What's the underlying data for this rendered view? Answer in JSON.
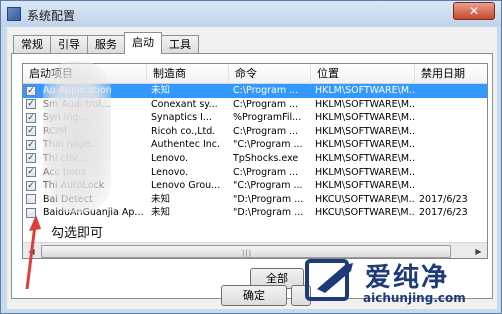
{
  "window": {
    "title": "系统配置",
    "close_glyph": "✕"
  },
  "tabs": [
    {
      "label": "常规",
      "active": false
    },
    {
      "label": "引导",
      "active": false
    },
    {
      "label": "服务",
      "active": false
    },
    {
      "label": "启动",
      "active": true
    },
    {
      "label": "工具",
      "active": false
    }
  ],
  "list": {
    "columns": [
      "启动项目",
      "制造商",
      "命令",
      "位置",
      "禁用日期"
    ],
    "rows": [
      {
        "checked": true,
        "item": "Ap  Application",
        "maker": "未知",
        "cmd": "C:\\Program ...",
        "loc": "HKLM\\SOFTWARE\\M...",
        "date": "",
        "selected": true
      },
      {
        "checked": true,
        "item": "Sm  Audi  trol...",
        "maker": "Conexant sy...",
        "cmd": "C:\\Program ...",
        "loc": "HKLM\\SOFTWARE\\M...",
        "date": ""
      },
      {
        "checked": true,
        "item": "Syn     ing...",
        "maker": "Synaptics I...",
        "cmd": "%ProgramFil...",
        "loc": "HKLM\\SOFTWARE\\M...",
        "date": ""
      },
      {
        "checked": true,
        "item": "RCIM  ",
        "maker": "Ricoh co.,Ltd.",
        "cmd": "C:\\Program ...",
        "loc": "HKLM\\SOFTWARE\\M...",
        "date": ""
      },
      {
        "checked": true,
        "item": "Thin    nage...",
        "maker": "Authentec Inc.",
        "cmd": "\"C:\\Program ...",
        "loc": "HKLM\\SOFTWARE\\M...",
        "date": ""
      },
      {
        "checked": true,
        "item": "Thi     ctiv...",
        "maker": "Lenovo.",
        "cmd": "TpShocks.exe",
        "loc": "HKLM\\SOFTWARE\\M...",
        "date": ""
      },
      {
        "checked": true,
        "item": "Acc     tions",
        "maker": "Lenovo.",
        "cmd": "C:\\Program ...",
        "loc": "HKLM\\SOFTWARE\\M...",
        "date": ""
      },
      {
        "checked": true,
        "item": "Thi    AutoLock",
        "maker": "Lenovo Grou...",
        "cmd": "\"C:\\Program ...",
        "loc": "HKLM\\SOFTWARE\\M...",
        "date": ""
      },
      {
        "checked": false,
        "item": "Bai    Detect",
        "maker": "未知",
        "cmd": "\"D:\\Program ...",
        "loc": "HKCU\\SOFTWARE\\M...",
        "date": "2017/6/23"
      },
      {
        "checked": false,
        "item": "BaiduAnGuanjia Ap...",
        "maker": "未知",
        "cmd": "\"D:\\Program ...",
        "loc": "HKCU\\SOFTWARE\\M...",
        "date": "2017/6/23"
      }
    ]
  },
  "buttons": {
    "enable_all": "全部",
    "ok": "确定"
  },
  "annotation": {
    "text": "勾选即可"
  },
  "watermark": {
    "brand": "爱纯净",
    "url": "aichunjing.com"
  },
  "colors": {
    "selection": "#3399ff",
    "annotation_arrow": "#e23b3b",
    "watermark": "#1e3a78"
  }
}
